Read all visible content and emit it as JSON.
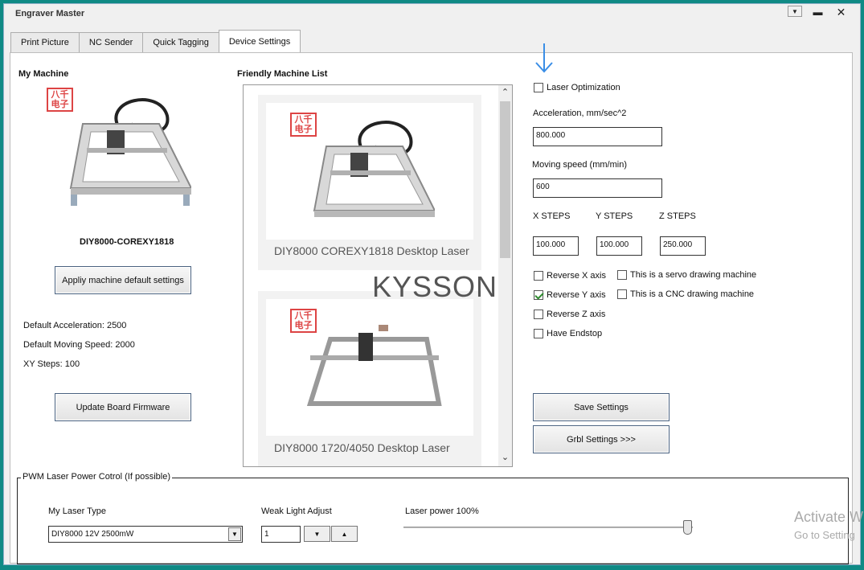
{
  "window": {
    "title": "Engraver Master",
    "help_icon": "help-icon",
    "minimize_icon": "minimize-icon",
    "close_icon": "close-icon"
  },
  "tabs": [
    {
      "label": "Print Picture",
      "active": false
    },
    {
      "label": "NC Sender",
      "active": false
    },
    {
      "label": "Quick Tagging",
      "active": false
    },
    {
      "label": "Device Settings",
      "active": true
    }
  ],
  "my_machine": {
    "heading": "My Machine",
    "logo_text": "八千电子",
    "name": "DIY8000-COREXY1818",
    "apply_button": "Appliy machine default settings",
    "default_acceleration": "Default Acceleration: 2500",
    "default_moving_speed": "Default Moving Speed: 2000",
    "xy_steps": "XY Steps: 100",
    "update_button": "Update Board Firmware"
  },
  "friendly_list": {
    "heading": "Friendly Machine List",
    "items": [
      {
        "label": "DIY8000 COREXY1818 Desktop Laser",
        "logo_text": "八千电子"
      },
      {
        "label": "DIY8000 1720/4050 Desktop Laser",
        "logo_text": "八千电子"
      }
    ],
    "watermark": "KYSSON"
  },
  "settings": {
    "arrow_icon": "down-arrow-icon",
    "laser_optimization": {
      "label": "Laser Optimization",
      "checked": false
    },
    "acceleration_label": "Acceleration, mm/sec^2",
    "acceleration_value": "800.000",
    "moving_speed_label": "Moving speed  (mm/min)",
    "moving_speed_value": "600",
    "x_steps_label": "X STEPS",
    "x_steps_value": "100.000",
    "y_steps_label": "Y STEPS",
    "y_steps_value": "100.000",
    "z_steps_label": "Z STEPS",
    "z_steps_value": "250.000",
    "reverse_x": {
      "label": "Reverse X axis",
      "checked": false
    },
    "reverse_y": {
      "label": "Reverse Y axis",
      "checked": true
    },
    "reverse_z": {
      "label": "Reverse Z axis",
      "checked": false
    },
    "have_endstop": {
      "label": "Have  Endstop",
      "checked": false
    },
    "servo_machine": {
      "label": "This is a servo drawing machine",
      "checked": false
    },
    "cnc_machine": {
      "label": "This is a CNC drawing machine",
      "checked": false
    },
    "save_button": "Save Settings",
    "grbl_button": "Grbl Settings >>>"
  },
  "pwm": {
    "group_title": "PWM Laser Power Cotrol (If possible)",
    "laser_type_label": "My Laser Type",
    "laser_type_value": "DIY8000 12V 2500mW",
    "weak_light_label": "Weak Light Adjust",
    "weak_light_value": "1",
    "laser_power_label": "Laser power 100%",
    "laser_power_fraction": 1.0
  },
  "activate_windows": {
    "line1": "Activate W",
    "line2": "Go to Setting"
  }
}
